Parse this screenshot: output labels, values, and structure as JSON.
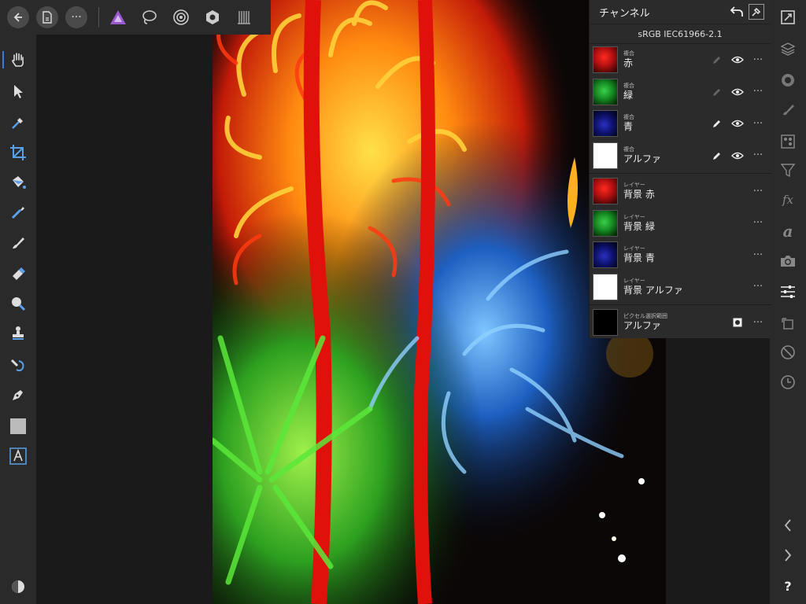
{
  "toolbar": {
    "back_icon": "arrow-left-icon",
    "document_icon": "document-icon",
    "more_label": "···",
    "personas": [
      "photo-persona-icon",
      "liquify-persona-icon",
      "develop-persona-icon",
      "tone-mapping-persona-icon",
      "export-persona-icon"
    ]
  },
  "left_tools": [
    "hand",
    "move",
    "color-picker",
    "crop",
    "flood-fill",
    "selection-brush",
    "paint-brush",
    "erase-brush",
    "dodge-burn",
    "clone",
    "healing",
    "pen",
    "rectangle",
    "artistic-text"
  ],
  "right_tools": [
    "canvas",
    "layers",
    "channels-color",
    "brushes",
    "swatches",
    "filters",
    "fx",
    "text-styles",
    "stock-camera",
    "adjustments",
    "transform",
    "history-undo",
    "history-clock"
  ],
  "panel": {
    "title": "チャンネル",
    "profile": "sRGB IEC61966-2.1",
    "composite": [
      {
        "small": "複合",
        "label": "赤",
        "color": "#d81a1a"
      },
      {
        "small": "複合",
        "label": "緑",
        "color": "#1a9a2a"
      },
      {
        "small": "複合",
        "label": "青",
        "color": "#141890"
      },
      {
        "small": "複合",
        "label": "アルファ",
        "color": "#ffffff"
      }
    ],
    "layer": [
      {
        "small": "レイヤー",
        "label": "背景 赤",
        "color": "#d81a1a"
      },
      {
        "small": "レイヤー",
        "label": "背景 緑",
        "color": "#1a9a2a"
      },
      {
        "small": "レイヤー",
        "label": "背景 青",
        "color": "#141890"
      },
      {
        "small": "レイヤー",
        "label": "背景 アルファ",
        "color": "#ffffff"
      }
    ],
    "selection": {
      "small": "ピクセル選択範囲",
      "label": "アルファ"
    },
    "more": "···"
  },
  "help_label": "?"
}
